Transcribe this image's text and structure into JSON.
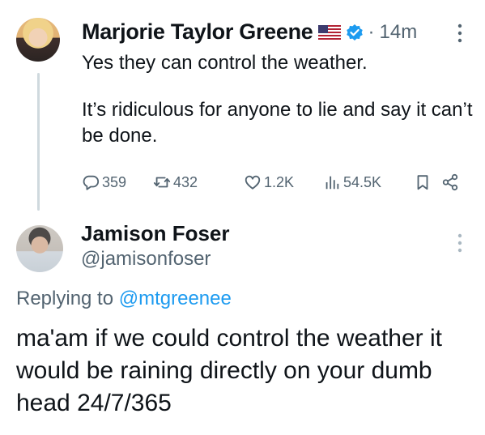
{
  "original_tweet": {
    "author_name": "Marjorie Taylor Greene",
    "flag_emoji": "us-flag",
    "verified": true,
    "separator": "·",
    "time_ago": "14m",
    "text_line1": "Yes they can control the weather.",
    "text_line2": "It’s ridiculous for anyone to lie and say it can’t be done.",
    "stats": {
      "replies": "359",
      "reposts": "432",
      "likes": "1.2K",
      "views": "54.5K"
    },
    "icons": {
      "reply": "speech-bubble-icon",
      "repost": "repost-icon",
      "like": "heart-icon",
      "views": "bar-chart-icon",
      "bookmark": "bookmark-icon",
      "share": "share-icon",
      "more": "more-vertical-icon"
    }
  },
  "reply_tweet": {
    "author_name": "Jamison Foser",
    "handle": "@jamisonfoser",
    "replying_prefix": "Replying to",
    "replying_to": "@mtgreenee",
    "text": "ma'am if we could control the weather it would be raining directly on your dumb head 24/7/365"
  },
  "colors": {
    "text": "#0f1419",
    "secondary": "#536471",
    "accent": "#1d9bf0",
    "thread_line": "#cfd9de"
  }
}
